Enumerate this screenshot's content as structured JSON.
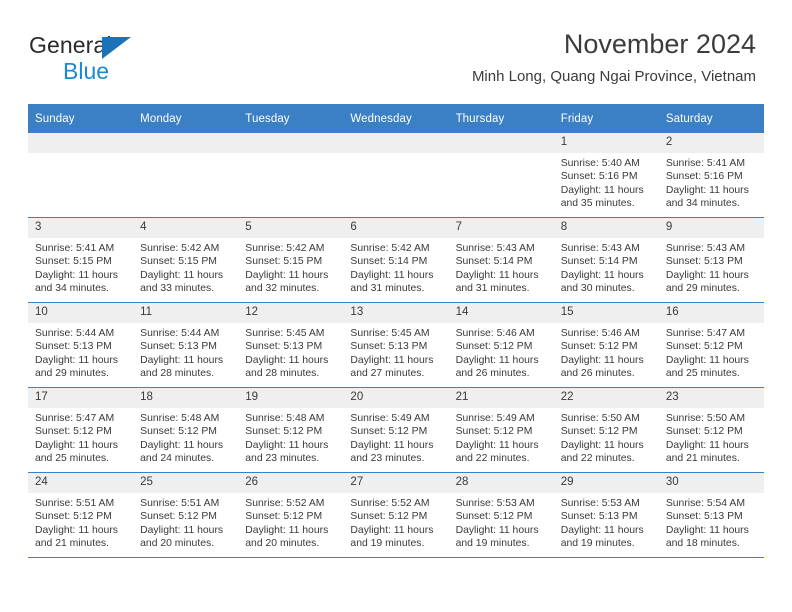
{
  "brand": {
    "name_part1": "General",
    "name_part2": "Blue",
    "triangle_color": "#1a72b8",
    "blue_color": "#1a8ad4"
  },
  "header": {
    "title": "November 2024",
    "subtitle": "Minh Long, Quang Ngai Province, Vietnam"
  },
  "theme": {
    "header_row_bg": "#3b7fc4",
    "daynum_bg": "#efefef",
    "text_color": "#3a3a3a"
  },
  "weekdays": [
    "Sunday",
    "Monday",
    "Tuesday",
    "Wednesday",
    "Thursday",
    "Friday",
    "Saturday"
  ],
  "labels": {
    "sunrise": "Sunrise:",
    "sunset": "Sunset:",
    "daylight": "Daylight:"
  },
  "weeks": [
    [
      {
        "day": "",
        "sunrise": "",
        "sunset": "",
        "daylight": ""
      },
      {
        "day": "",
        "sunrise": "",
        "sunset": "",
        "daylight": ""
      },
      {
        "day": "",
        "sunrise": "",
        "sunset": "",
        "daylight": ""
      },
      {
        "day": "",
        "sunrise": "",
        "sunset": "",
        "daylight": ""
      },
      {
        "day": "",
        "sunrise": "",
        "sunset": "",
        "daylight": ""
      },
      {
        "day": "1",
        "sunrise": "Sunrise: 5:40 AM",
        "sunset": "Sunset: 5:16 PM",
        "daylight": "Daylight: 11 hours and 35 minutes."
      },
      {
        "day": "2",
        "sunrise": "Sunrise: 5:41 AM",
        "sunset": "Sunset: 5:16 PM",
        "daylight": "Daylight: 11 hours and 34 minutes."
      }
    ],
    [
      {
        "day": "3",
        "sunrise": "Sunrise: 5:41 AM",
        "sunset": "Sunset: 5:15 PM",
        "daylight": "Daylight: 11 hours and 34 minutes."
      },
      {
        "day": "4",
        "sunrise": "Sunrise: 5:42 AM",
        "sunset": "Sunset: 5:15 PM",
        "daylight": "Daylight: 11 hours and 33 minutes."
      },
      {
        "day": "5",
        "sunrise": "Sunrise: 5:42 AM",
        "sunset": "Sunset: 5:15 PM",
        "daylight": "Daylight: 11 hours and 32 minutes."
      },
      {
        "day": "6",
        "sunrise": "Sunrise: 5:42 AM",
        "sunset": "Sunset: 5:14 PM",
        "daylight": "Daylight: 11 hours and 31 minutes."
      },
      {
        "day": "7",
        "sunrise": "Sunrise: 5:43 AM",
        "sunset": "Sunset: 5:14 PM",
        "daylight": "Daylight: 11 hours and 31 minutes."
      },
      {
        "day": "8",
        "sunrise": "Sunrise: 5:43 AM",
        "sunset": "Sunset: 5:14 PM",
        "daylight": "Daylight: 11 hours and 30 minutes."
      },
      {
        "day": "9",
        "sunrise": "Sunrise: 5:43 AM",
        "sunset": "Sunset: 5:13 PM",
        "daylight": "Daylight: 11 hours and 29 minutes."
      }
    ],
    [
      {
        "day": "10",
        "sunrise": "Sunrise: 5:44 AM",
        "sunset": "Sunset: 5:13 PM",
        "daylight": "Daylight: 11 hours and 29 minutes."
      },
      {
        "day": "11",
        "sunrise": "Sunrise: 5:44 AM",
        "sunset": "Sunset: 5:13 PM",
        "daylight": "Daylight: 11 hours and 28 minutes."
      },
      {
        "day": "12",
        "sunrise": "Sunrise: 5:45 AM",
        "sunset": "Sunset: 5:13 PM",
        "daylight": "Daylight: 11 hours and 28 minutes."
      },
      {
        "day": "13",
        "sunrise": "Sunrise: 5:45 AM",
        "sunset": "Sunset: 5:13 PM",
        "daylight": "Daylight: 11 hours and 27 minutes."
      },
      {
        "day": "14",
        "sunrise": "Sunrise: 5:46 AM",
        "sunset": "Sunset: 5:12 PM",
        "daylight": "Daylight: 11 hours and 26 minutes."
      },
      {
        "day": "15",
        "sunrise": "Sunrise: 5:46 AM",
        "sunset": "Sunset: 5:12 PM",
        "daylight": "Daylight: 11 hours and 26 minutes."
      },
      {
        "day": "16",
        "sunrise": "Sunrise: 5:47 AM",
        "sunset": "Sunset: 5:12 PM",
        "daylight": "Daylight: 11 hours and 25 minutes."
      }
    ],
    [
      {
        "day": "17",
        "sunrise": "Sunrise: 5:47 AM",
        "sunset": "Sunset: 5:12 PM",
        "daylight": "Daylight: 11 hours and 25 minutes."
      },
      {
        "day": "18",
        "sunrise": "Sunrise: 5:48 AM",
        "sunset": "Sunset: 5:12 PM",
        "daylight": "Daylight: 11 hours and 24 minutes."
      },
      {
        "day": "19",
        "sunrise": "Sunrise: 5:48 AM",
        "sunset": "Sunset: 5:12 PM",
        "daylight": "Daylight: 11 hours and 23 minutes."
      },
      {
        "day": "20",
        "sunrise": "Sunrise: 5:49 AM",
        "sunset": "Sunset: 5:12 PM",
        "daylight": "Daylight: 11 hours and 23 minutes."
      },
      {
        "day": "21",
        "sunrise": "Sunrise: 5:49 AM",
        "sunset": "Sunset: 5:12 PM",
        "daylight": "Daylight: 11 hours and 22 minutes."
      },
      {
        "day": "22",
        "sunrise": "Sunrise: 5:50 AM",
        "sunset": "Sunset: 5:12 PM",
        "daylight": "Daylight: 11 hours and 22 minutes."
      },
      {
        "day": "23",
        "sunrise": "Sunrise: 5:50 AM",
        "sunset": "Sunset: 5:12 PM",
        "daylight": "Daylight: 11 hours and 21 minutes."
      }
    ],
    [
      {
        "day": "24",
        "sunrise": "Sunrise: 5:51 AM",
        "sunset": "Sunset: 5:12 PM",
        "daylight": "Daylight: 11 hours and 21 minutes."
      },
      {
        "day": "25",
        "sunrise": "Sunrise: 5:51 AM",
        "sunset": "Sunset: 5:12 PM",
        "daylight": "Daylight: 11 hours and 20 minutes."
      },
      {
        "day": "26",
        "sunrise": "Sunrise: 5:52 AM",
        "sunset": "Sunset: 5:12 PM",
        "daylight": "Daylight: 11 hours and 20 minutes."
      },
      {
        "day": "27",
        "sunrise": "Sunrise: 5:52 AM",
        "sunset": "Sunset: 5:12 PM",
        "daylight": "Daylight: 11 hours and 19 minutes."
      },
      {
        "day": "28",
        "sunrise": "Sunrise: 5:53 AM",
        "sunset": "Sunset: 5:12 PM",
        "daylight": "Daylight: 11 hours and 19 minutes."
      },
      {
        "day": "29",
        "sunrise": "Sunrise: 5:53 AM",
        "sunset": "Sunset: 5:13 PM",
        "daylight": "Daylight: 11 hours and 19 minutes."
      },
      {
        "day": "30",
        "sunrise": "Sunrise: 5:54 AM",
        "sunset": "Sunset: 5:13 PM",
        "daylight": "Daylight: 11 hours and 18 minutes."
      }
    ]
  ]
}
